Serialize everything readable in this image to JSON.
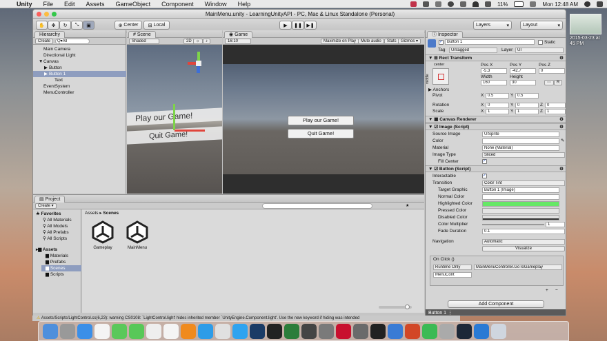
{
  "menubar": {
    "apple": "",
    "app": "Unity",
    "items": [
      "File",
      "Edit",
      "Assets",
      "GameObject",
      "Component",
      "Window",
      "Help"
    ],
    "battery": "11%",
    "time": "Mon 12:48 AM"
  },
  "desktop": {
    "date_line1": "2015-03-23 at",
    "date_line2": "45 PM"
  },
  "window": {
    "title": "MainMenu.unity - LearningUnityAPI - PC, Mac & Linux Standalone (Personal)"
  },
  "toolbar": {
    "center": "Center",
    "local": "Local",
    "layers": "Layers",
    "layout": "Layout"
  },
  "hierarchy": {
    "tab": "Hierarchy",
    "create": "Create",
    "search": "Q▾All",
    "items": [
      {
        "label": "Main Camera",
        "indent": 1,
        "arrow": ""
      },
      {
        "label": "Directional Light",
        "indent": 1,
        "arrow": ""
      },
      {
        "label": "Canvas",
        "indent": 1,
        "arrow": "▼"
      },
      {
        "label": "Button",
        "indent": 2,
        "arrow": "▶"
      },
      {
        "label": "Button 1",
        "indent": 2,
        "arrow": "▶",
        "selected": true
      },
      {
        "label": "Text",
        "indent": 3,
        "arrow": ""
      },
      {
        "label": "EventSystem",
        "indent": 1,
        "arrow": ""
      },
      {
        "label": "MenuController",
        "indent": 1,
        "arrow": ""
      }
    ]
  },
  "scene": {
    "tab": "Scene",
    "shaded": "Shaded",
    "mode2d": "2D",
    "play_label": "Play our Game!",
    "quit_label": "Quit Game!"
  },
  "game": {
    "tab": "Game",
    "aspect": "16:10",
    "maximize": "Maximize on Play",
    "mute": "Mute audio",
    "stats": "Stats",
    "gizmos": "Gizmos ▾",
    "play_label": "Play our Game!",
    "quit_label": "Quit Game!"
  },
  "project": {
    "tab": "Project",
    "create": "Create ▾",
    "breadcrumb_root": "Assets",
    "breadcrumb_sep": "▸",
    "breadcrumb_current": "Scenes",
    "favorites_label": "Favorites",
    "favorites": [
      "All Materials",
      "All Models",
      "All Prefabs",
      "All Scripts"
    ],
    "assets_label": "Assets",
    "folders": [
      "Materials",
      "Prefabs",
      "Scenes",
      "Scripts"
    ],
    "files": [
      "Gameplay",
      "MainMenu"
    ]
  },
  "status": {
    "text": "Assets/Scripts/LightControl.cs(6,23): warning CS0108: `LightControl.light' hides inherited member `UnityEngine.Component.light'. Use the new keyword if hiding was intended"
  },
  "inspector": {
    "tab": "Inspector",
    "name": "Button 1",
    "static": "Static",
    "tag_label": "Tag",
    "tag": "Untagged",
    "layer_label": "Layer",
    "layer": "UI",
    "rect_title": "Rect Transform",
    "anchor_label": "center",
    "anchor_side": "middle",
    "pos_x_label": "Pos X",
    "pos_y_label": "Pos Y",
    "pos_z_label": "Pos Z",
    "pos_x": "-5.3",
    "pos_y": "-42.7",
    "pos_z": "0",
    "width_label": "Width",
    "height_label": "Height",
    "width": "160",
    "height": "30",
    "r_label": "R",
    "anchors": "Anchors",
    "pivot": "Pivot",
    "pivot_x": "0.5",
    "pivot_y": "0.5",
    "rotation": "Rotation",
    "rot_x": "0",
    "rot_y": "0",
    "rot_z": "0",
    "scale": "Scale",
    "scale_x": "1",
    "scale_y": "1",
    "scale_z": "1",
    "canvas_renderer": "Canvas Renderer",
    "image_title": "Image (Script)",
    "source_image_label": "Source Image",
    "source_image": "UISprite",
    "color_label": "Color",
    "material_label": "Material",
    "material": "None (Material)",
    "image_type_label": "Image Type",
    "image_type": "Sliced",
    "fill_center_label": "Fill Center",
    "button_title": "Button (Script)",
    "interactable_label": "Interactable",
    "transition_label": "Transition",
    "transition": "Color Tint",
    "target_graphic_label": "Target Graphic",
    "target_graphic": "Button 1 (Image)",
    "normal_color_label": "Normal Color",
    "highlighted_color_label": "Highlighted Color",
    "pressed_color_label": "Pressed Color",
    "disabled_color_label": "Disabled Color",
    "multiplier_label": "Color Multiplier",
    "multiplier": "1",
    "fade_label": "Fade Duration",
    "fade": "0.1",
    "navigation_label": "Navigation",
    "navigation": "Automatic",
    "visualize": "Visualize",
    "onclick_label": "On Click ()",
    "runtime": "Runtime Only",
    "function": "MainMenuController.GoToGameplay",
    "object": "MenuCont",
    "add_component": "Add Component",
    "footer": "Button 1"
  },
  "colors": {
    "highlighted": "#66e866",
    "selection": "#8e9dbf"
  }
}
